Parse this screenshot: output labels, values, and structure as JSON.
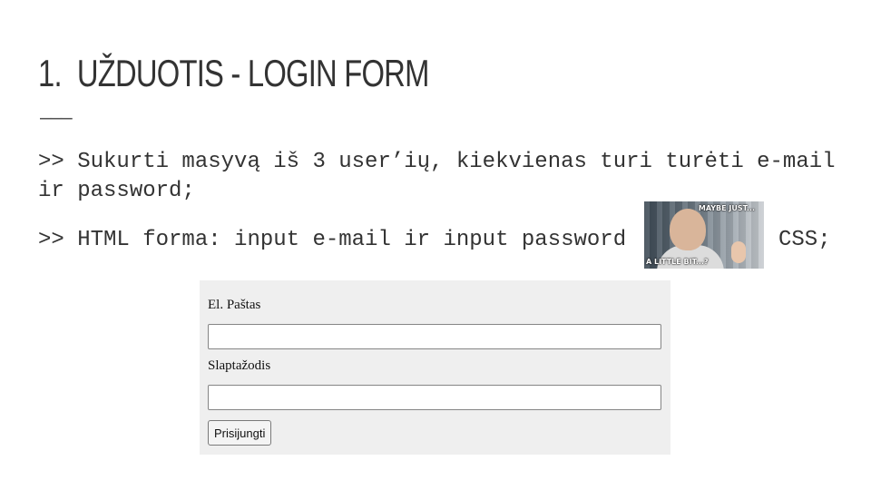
{
  "slide": {
    "title_number": "1.",
    "title_text": "UŽDUOTIS - LOGIN FORM",
    "divider": "———",
    "line1": ">> Sukurti masyvą iš 3 user’ių, kiekvienas turi turėti e-mail",
    "line2": "ir password;",
    "line3": ">> HTML forma: input e-mail ir input password",
    "line3_end": "CSS;"
  },
  "meme": {
    "caption_top": "MAYBE JUST...",
    "caption_bottom": "A LITTLE BIT...?"
  },
  "form": {
    "email_label": "El. Paštas",
    "email_value": "",
    "password_label": "Slaptažodis",
    "password_value": "",
    "submit_label": "Prisijungti"
  }
}
